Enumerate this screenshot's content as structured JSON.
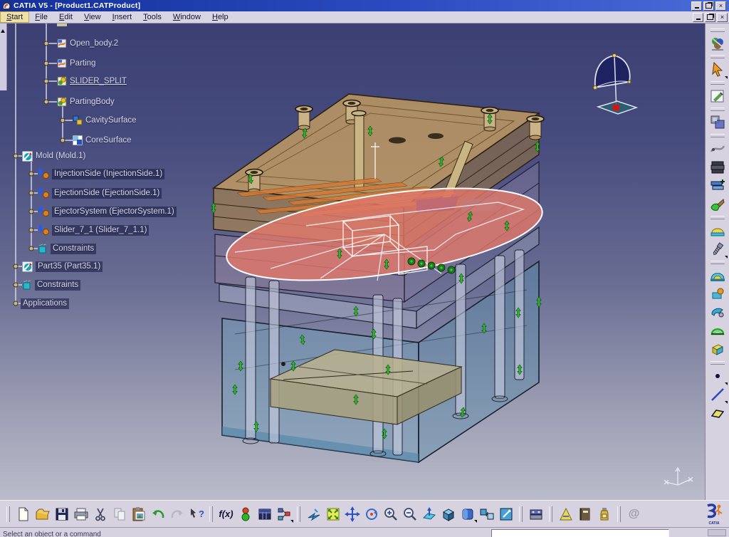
{
  "window": {
    "title": "CATIA V5 - [Product1.CATProduct]",
    "close_glyph": "×"
  },
  "menu": {
    "items": [
      "Start",
      "File",
      "Edit",
      "View",
      "Insert",
      "Tools",
      "Window",
      "Help"
    ],
    "active": "Start"
  },
  "tree": {
    "items": [
      {
        "label": "Open_body.2",
        "icon": "surface-body-icon"
      },
      {
        "label": "Parting",
        "icon": "surface-body-icon"
      },
      {
        "label": "SLIDER_SPLIT",
        "icon": "split-body-icon",
        "underlined": true
      },
      {
        "label": "PartingBody",
        "icon": "split-body-icon"
      },
      {
        "label": "CavitySurface",
        "icon": "cavity-surface-icon"
      },
      {
        "label": "CoreSurface",
        "icon": "core-surface-icon"
      },
      {
        "label": "Mold (Mold.1)",
        "icon": "product-icon"
      },
      {
        "label": "InjectionSide (InjectionSide.1)",
        "icon": "component-icon"
      },
      {
        "label": "EjectionSide (EjectionSide.1)",
        "icon": "component-icon"
      },
      {
        "label": "EjectorSystem (EjectorSystem.1)",
        "icon": "component-icon"
      },
      {
        "label": "Slider_7_1 (Slider_7_1.1)",
        "icon": "component-icon"
      },
      {
        "label": "Constraints",
        "icon": "constraints-icon"
      },
      {
        "label": "Part35 (Part35.1)",
        "icon": "product-icon"
      },
      {
        "label": "Constraints",
        "icon": "constraints-icon"
      },
      {
        "label": "Applications",
        "icon": "none"
      }
    ]
  },
  "viewport": {
    "background_top": "#3b3f72",
    "background_bottom": "#babccb",
    "model": {
      "description": "injection mold assembly, transparent shaded with wireframe",
      "colors": {
        "injection_side_plates": "#c9a05f",
        "cooling_channels": "#cf7a35",
        "parting_surface": "#e0786a",
        "parting_outline": "#ffffff",
        "middle_plates": "#97819b",
        "mold_base": "#6f9cb8",
        "guide_pillars": "#c6cce0",
        "ejector_plate": "#b5ad8d",
        "constraint_symbols": "#2db42d",
        "slider_wireframe": "#ffffff"
      }
    },
    "compass": {
      "base_marker_color": "#dd1111",
      "dome_color": "#1b2060"
    }
  },
  "right_toolbar": {
    "icons": [
      "mold-tooling-workbench-icon",
      "select-arrow-icon",
      "sketcher-icon",
      "powercopy-icon",
      "measure-curve-icon",
      "mold-base-icon",
      "add-plate-icon",
      "gate-icon",
      "cavity-dome-icon",
      "screw-icon",
      "insert-dome-icon",
      "insert-component-icon",
      "tooling-tool-icon",
      "green-dome-icon",
      "standard-part-icon",
      "point-icon",
      "line-icon",
      "plane-icon"
    ]
  },
  "bottom_toolbar": {
    "icons": [
      "new-document-icon",
      "open-folder-icon",
      "save-icon",
      "print-icon",
      "cut-icon",
      "copy-icon",
      "paste-icon",
      "undo-icon",
      "redo-icon",
      "whats-this-icon",
      "formula-icon",
      "knowledge-icon",
      "design-table-icon",
      "relations-icon",
      "fly-mode-icon",
      "fit-all-icon",
      "pan-icon",
      "rotate-icon",
      "zoom-in-icon",
      "zoom-out-icon",
      "normal-view-icon",
      "iso-view-icon",
      "shading-icon",
      "hide-show-icon",
      "swap-space-icon",
      "mold-plate-icon",
      "measure-icon",
      "catalog-icon",
      "material-icon",
      "at-link-icon",
      "catia-logo"
    ],
    "fx_label": "f(x)",
    "help_glyph": "?",
    "at_glyph": "@",
    "logo_text": "CATIA"
  },
  "status_bar": {
    "message": "Select an object or a command"
  }
}
